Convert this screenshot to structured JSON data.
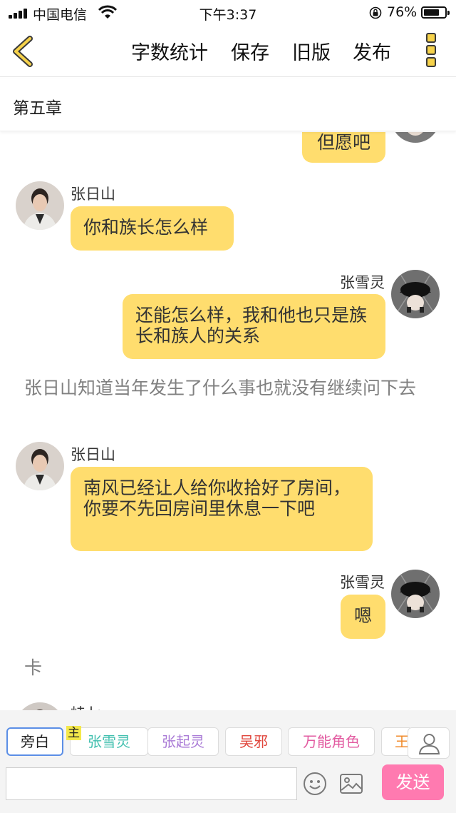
{
  "status_bar": {
    "carrier": "中国电信",
    "time": "下午3:37",
    "battery": "76%",
    "battery_level": 0.76
  },
  "toolbar": {
    "word_count": "字数统计",
    "save": "保存",
    "old_version": "旧版",
    "publish": "发布"
  },
  "chapter": {
    "title": "第五章"
  },
  "messages": [
    {
      "text": "但愿吧"
    },
    {
      "speaker": "张日山",
      "text": "你和族长怎么样"
    },
    {
      "speaker": "张雪灵",
      "text": "还能怎么样，我和他也只是族长和族人的关系"
    },
    {
      "narration": "张日山知道当年发生了什么事也就没有继续问下去"
    },
    {
      "speaker": "张日山",
      "text": "南风已经让人给你收拾好了房间，你要不先回房间里休息一下吧"
    },
    {
      "speaker": "张雪灵",
      "text": "嗯"
    },
    {
      "narration": "卡"
    },
    {
      "speaker": "峙七"
    }
  ],
  "role_bar": {
    "badge": "主",
    "roles": [
      {
        "label": "旁白",
        "color": "#222222"
      },
      {
        "label": "张雪灵",
        "color": "#3fbfae"
      },
      {
        "label": "张起灵",
        "color": "#a97ad6"
      },
      {
        "label": "吴邪",
        "color": "#e0463c"
      },
      {
        "label": "万能角色",
        "color": "#e25aa0"
      },
      {
        "label": "王",
        "color": "#f08a2a"
      }
    ]
  },
  "composer": {
    "input_value": "",
    "send": "发送"
  },
  "colors": {
    "accent": "#ffdd6e",
    "send_button": "#ff7ab0",
    "narration_text": "#808080"
  }
}
